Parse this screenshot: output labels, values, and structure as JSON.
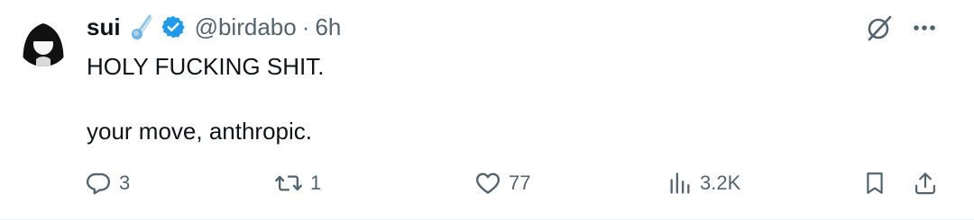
{
  "tweet": {
    "author_name": "sui",
    "author_emoji": "comet-emoji",
    "verified_icon": "verified-badge-icon",
    "handle": "@birdabo",
    "separator": "·",
    "time": "6h",
    "lines": [
      "HOLY FUCKING SHIT.",
      "your move, anthropic."
    ]
  },
  "actions": {
    "replies": "3",
    "reposts": "1",
    "likes": "77",
    "views": "3.2K"
  },
  "icons": {
    "reply": "reply-icon",
    "repost": "repost-icon",
    "like": "heart-icon",
    "views": "views-icon",
    "bookmark": "bookmark-icon",
    "share": "share-icon",
    "grok": "grok-icon",
    "more": "more-icon"
  },
  "colors": {
    "text": "#0f1419",
    "secondary": "#536471",
    "verified": "#1d9bf0"
  }
}
